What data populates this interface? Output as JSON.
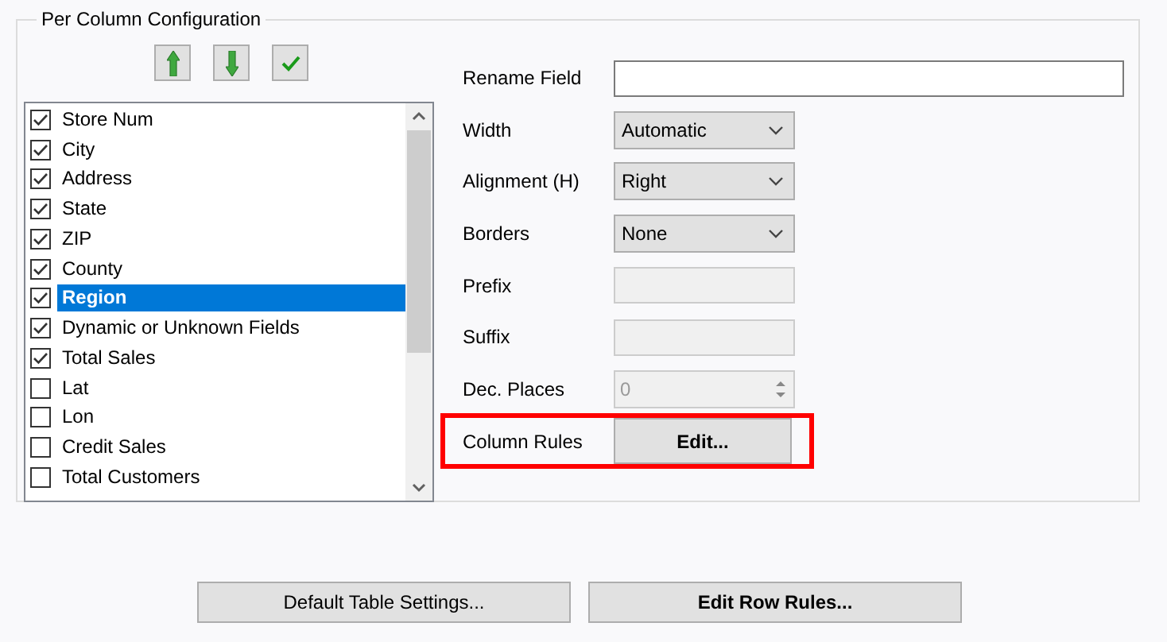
{
  "group": {
    "title": "Per Column Configuration"
  },
  "toolbar": [
    {
      "kind": "up"
    },
    {
      "kind": "down"
    },
    {
      "kind": "check"
    }
  ],
  "columns": [
    {
      "label": "Store Num",
      "checked": true,
      "selected": false
    },
    {
      "label": "City",
      "checked": true,
      "selected": false
    },
    {
      "label": "Address",
      "checked": true,
      "selected": false
    },
    {
      "label": "State",
      "checked": true,
      "selected": false
    },
    {
      "label": "ZIP",
      "checked": true,
      "selected": false
    },
    {
      "label": "County",
      "checked": true,
      "selected": false
    },
    {
      "label": "Region",
      "checked": true,
      "selected": true
    },
    {
      "label": "Dynamic or Unknown Fields",
      "checked": true,
      "selected": false
    },
    {
      "label": "Total Sales",
      "checked": true,
      "selected": false
    },
    {
      "label": "Lat",
      "checked": false,
      "selected": false
    },
    {
      "label": "Lon",
      "checked": false,
      "selected": false
    },
    {
      "label": "Credit Sales",
      "checked": false,
      "selected": false
    },
    {
      "label": "Total Customers",
      "checked": false,
      "selected": false
    }
  ],
  "fields": [
    {
      "kind": "text",
      "label": "Rename Field",
      "disabled": false
    },
    {
      "kind": "select",
      "label": "Width",
      "value": "Automatic"
    },
    {
      "kind": "select",
      "label": "Alignment (H)",
      "value": "Right"
    },
    {
      "kind": "select",
      "label": "Borders",
      "value": "None"
    },
    {
      "kind": "text",
      "label": "Prefix",
      "disabled": true
    },
    {
      "kind": "text",
      "label": "Suffix",
      "disabled": true
    },
    {
      "kind": "spinner",
      "label": "Dec. Places",
      "value": "0",
      "disabled": true
    },
    {
      "kind": "button",
      "label": "Column Rules",
      "value": "Edit...",
      "highlighted": true
    }
  ],
  "buttons": [
    {
      "label": "Default Table Settings...",
      "bold": false
    },
    {
      "label": "Edit Row Rules...",
      "bold": true
    }
  ]
}
